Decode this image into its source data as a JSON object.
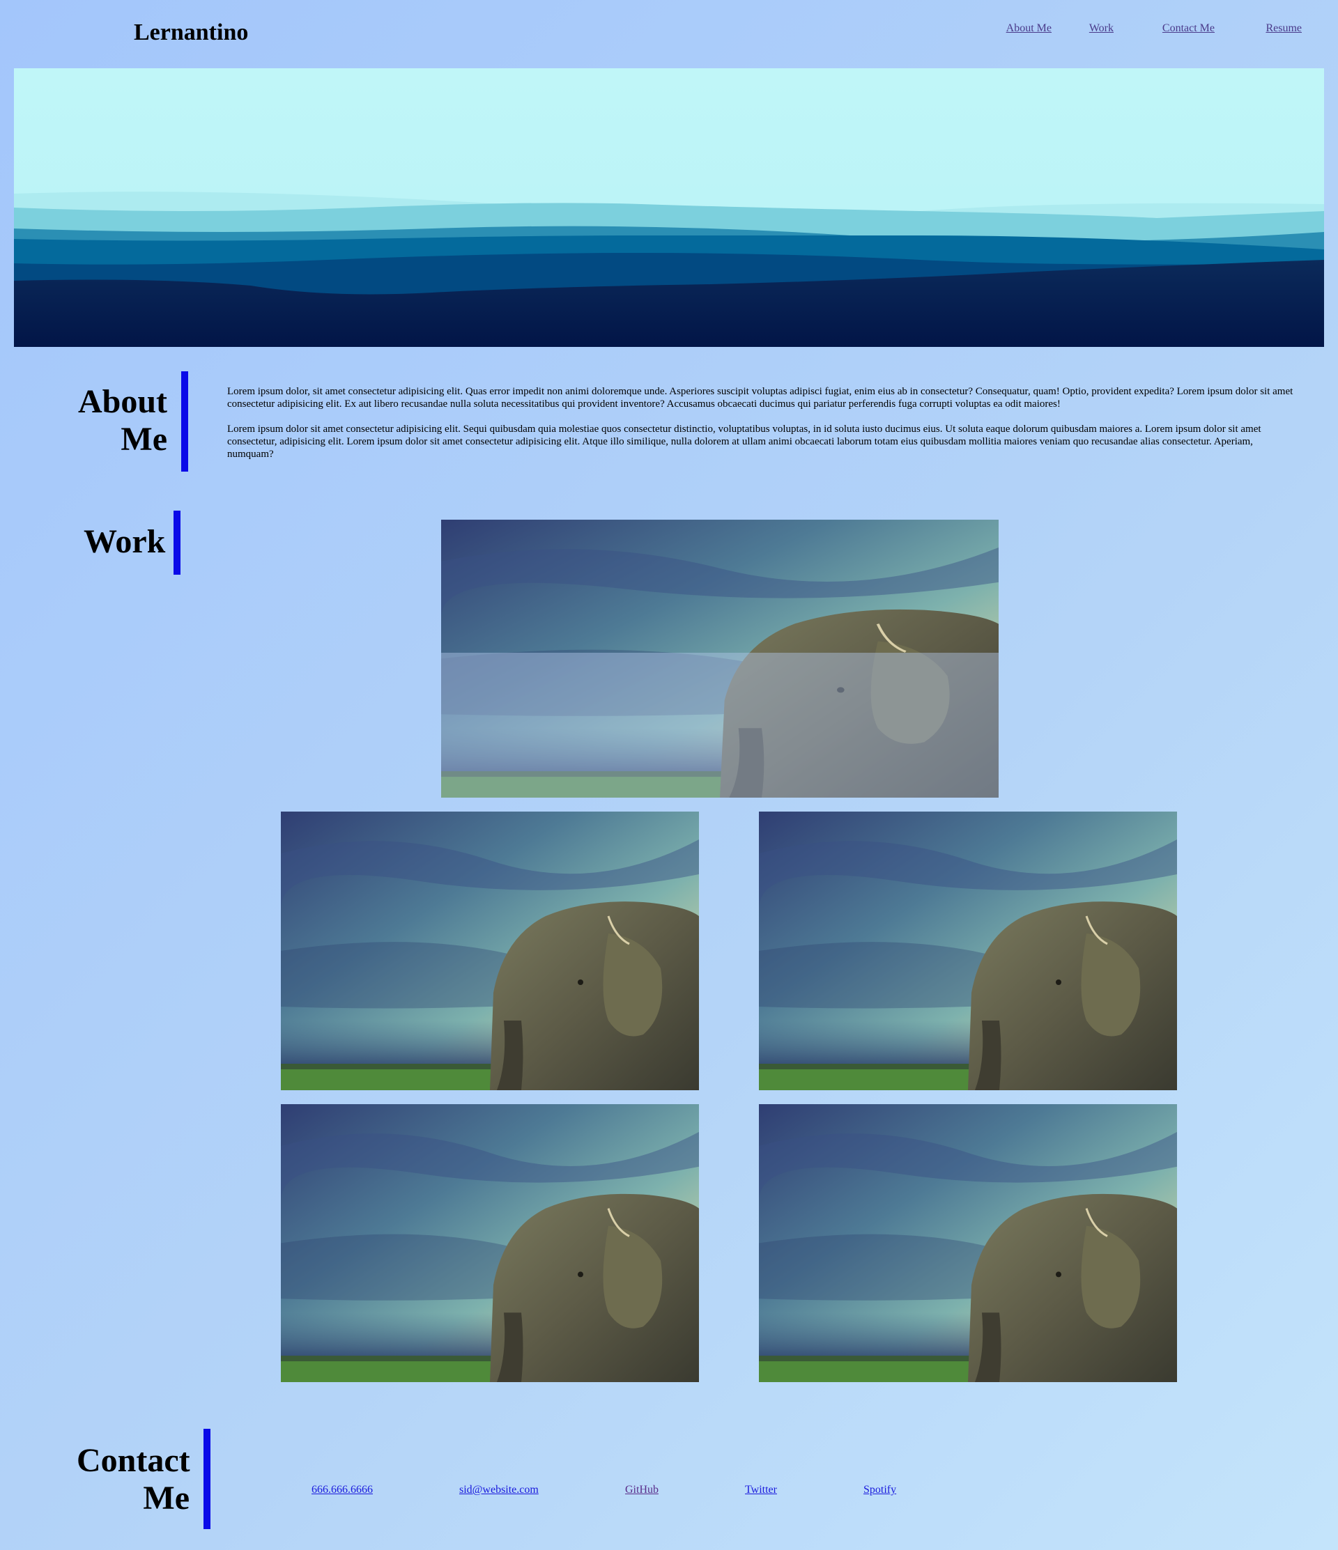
{
  "header": {
    "title": "Lernantino",
    "nav": [
      {
        "label": "About Me"
      },
      {
        "label": "Work"
      },
      {
        "label": "Contact Me"
      },
      {
        "label": "Resume"
      }
    ]
  },
  "hero": {
    "image": "mountain-landscape-illustration"
  },
  "about": {
    "heading_line1": "About",
    "heading_line2": "Me",
    "paragraphs": [
      "Lorem ipsum dolor, sit amet consectetur adipisicing elit. Quas error impedit non animi doloremque unde. Asperiores suscipit voluptas adipisci fugiat, enim eius ab in consectetur? Consequatur, quam! Optio, provident expedita? Lorem ipsum dolor sit amet consectetur adipisicing elit. Ex aut libero recusandae nulla soluta necessitatibus qui provident inventore? Accusamus obcaecati ducimus qui pariatur perferendis fuga corrupti voluptas ea odit maiores!",
      "Lorem ipsum dolor sit amet consectetur adipisicing elit. Sequi quibusdam quia molestiae quos consectetur distinctio, voluptatibus voluptas, in id soluta iusto ducimus eius. Ut soluta eaque dolorum quibusdam maiores a. Lorem ipsum dolor sit amet consectetur, adipisicing elit. Lorem ipsum dolor sit amet consectetur adipisicing elit. Atque illo similique, nulla dolorem at ullam animi obcaecati laborum totam eius quibusdam mollitia maiores veniam quo recusandae alias consectetur. Aperiam, numquam?"
    ]
  },
  "work": {
    "heading": "Work",
    "images": [
      {
        "name": "elephant-photo",
        "featured": true
      },
      {
        "name": "elephant-photo"
      },
      {
        "name": "elephant-photo"
      },
      {
        "name": "elephant-photo"
      },
      {
        "name": "elephant-photo"
      }
    ]
  },
  "contact": {
    "heading_line1": "Contact",
    "heading_line2": "Me",
    "links": [
      {
        "label": "666.666.6666"
      },
      {
        "label": "sid@website.com"
      },
      {
        "label": "GitHub"
      },
      {
        "label": "Twitter"
      },
      {
        "label": "Spotify"
      }
    ]
  },
  "colors": {
    "accent_bar": "#0a0ae8",
    "background_start": "#a3c6fb",
    "background_end": "#c4e4fb"
  }
}
